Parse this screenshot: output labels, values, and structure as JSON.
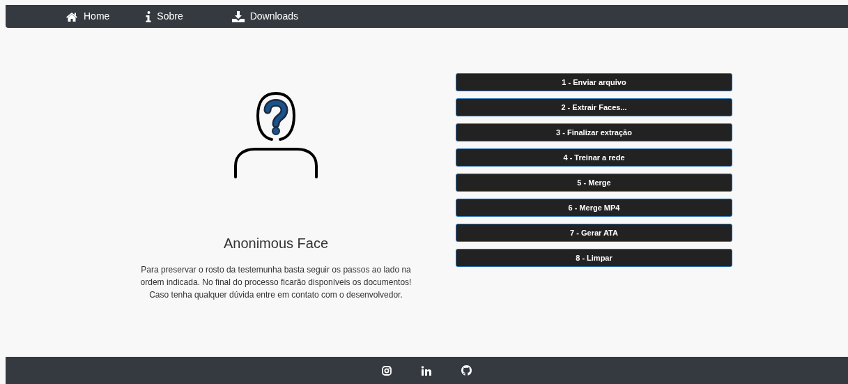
{
  "nav": [
    {
      "label": "Home"
    },
    {
      "label": "Sobre"
    },
    {
      "label": "Downloads"
    }
  ],
  "title": "Anonimous Face",
  "description": "Para preservar o rosto da testemunha basta seguir os passos ao lado na ordem indicada. No final do processo ficarão disponíveis os documentos! Caso tenha qualquer dúvida entre em contato com o desenvolvedor.",
  "steps": [
    "1 - Enviar arquivo",
    "2 - Extrair Faces...",
    "3 - Finalizar extração",
    "4 - Treinar a rede",
    "5 - Merge",
    "6 - Merge MP4",
    "7 - Gerar ATA",
    "8 - Limpar"
  ]
}
